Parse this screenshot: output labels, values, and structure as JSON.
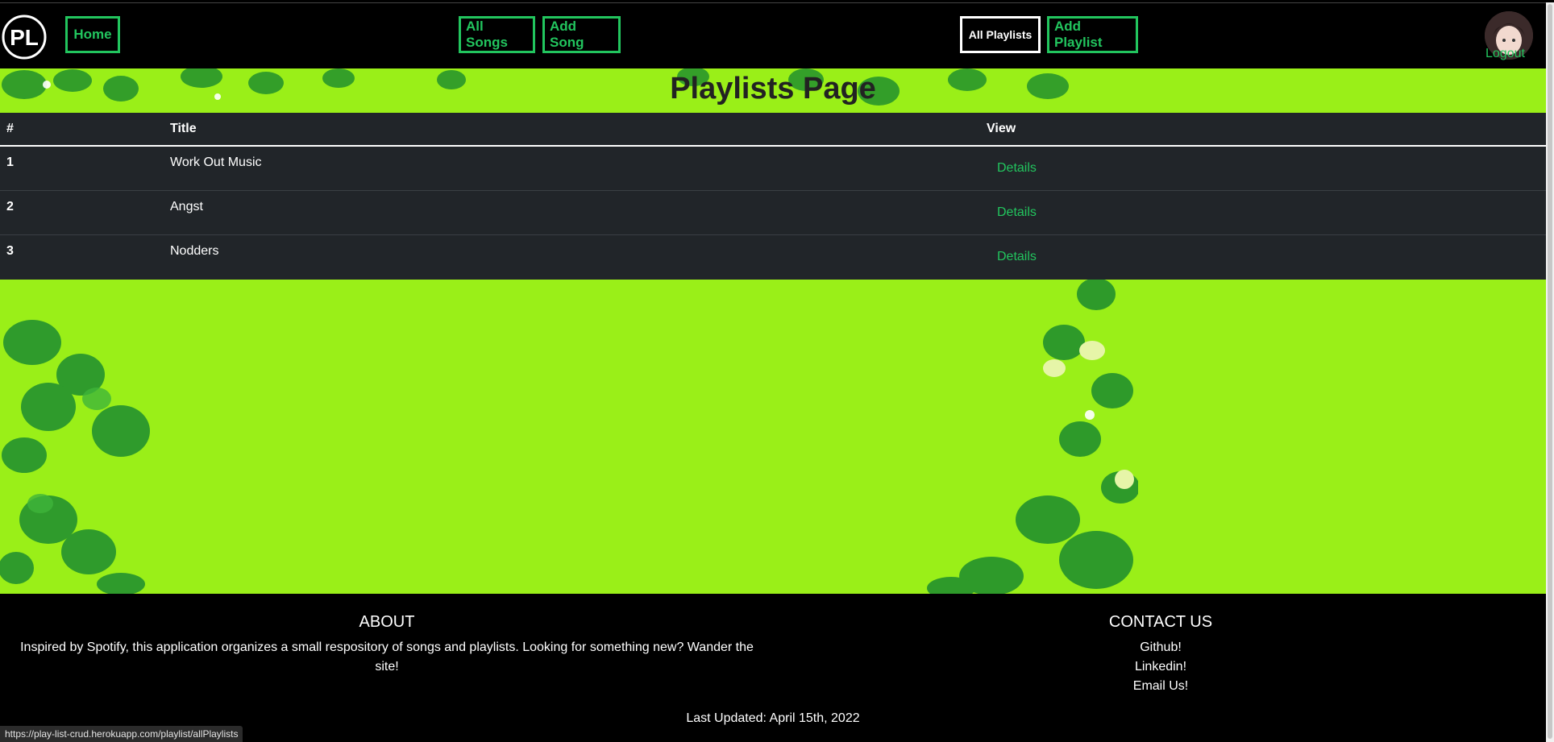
{
  "nav": {
    "home": "Home",
    "all_songs": "All Songs",
    "add_song": "Add Song",
    "all_playlists": "All Playlists",
    "add_playlist": "Add Playlist",
    "logout": "Logout",
    "logo_text": "PL"
  },
  "page": {
    "title": "Playlists Page"
  },
  "table": {
    "headers": {
      "num": "#",
      "title": "Title",
      "view": "View"
    },
    "rows": [
      {
        "num": "1",
        "title": "Work Out Music",
        "view": "Details"
      },
      {
        "num": "2",
        "title": "Angst",
        "view": "Details"
      },
      {
        "num": "3",
        "title": "Nodders",
        "view": "Details"
      }
    ]
  },
  "footer": {
    "about_heading": "ABOUT",
    "about_text": "Inspired by Spotify, this application organizes a small respository of songs and playlists. Looking for something new? Wander the site!",
    "contact_heading": "CONTACT US",
    "contact_links": [
      "Github!",
      "Linkedin!",
      "Email Us!"
    ],
    "last_updated": "Last Updated: April 15th, 2022"
  },
  "status_bar": {
    "url": "https://play-list-crud.herokuapp.com/playlist/allPlaylists"
  },
  "colors": {
    "accent": "#22c55e",
    "background_green": "#9aef18",
    "table_bg": "#212529"
  },
  "icons": {
    "logo": "pl-logo-icon",
    "avatar": "user-avatar"
  }
}
